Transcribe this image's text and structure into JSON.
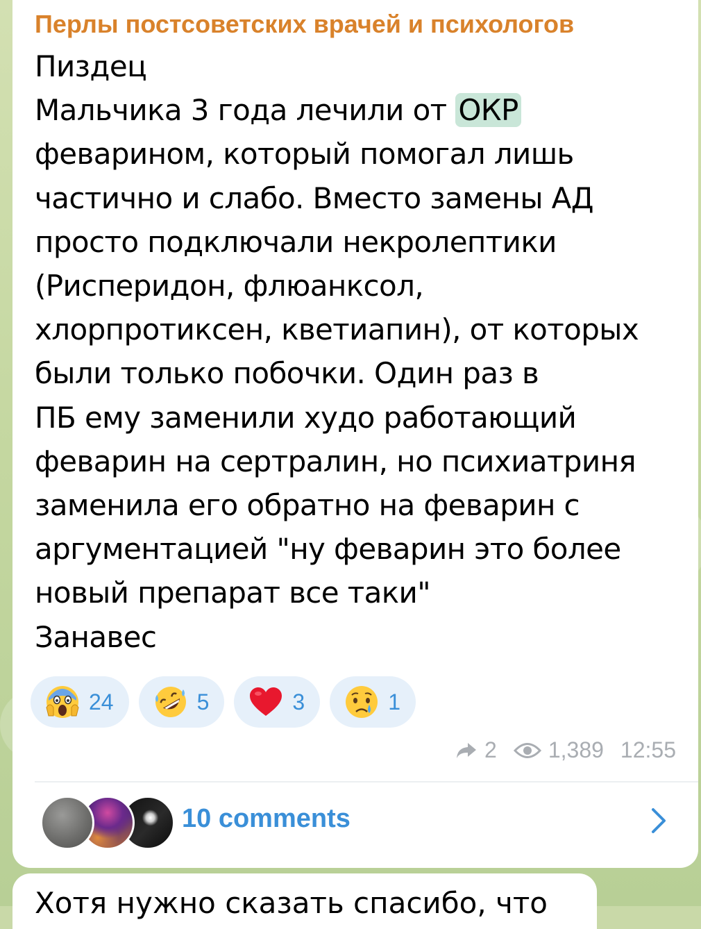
{
  "channel": {
    "name": "Перлы постсоветских врачей и психологов"
  },
  "message": {
    "lines": [
      "Пиздец",
      "Мальчика 3 года лечили от ",
      "феварином, который помогал лишь",
      "частично и слабо. Вместо замены АД",
      "просто подключали некролептики",
      "(Рисперидон, флюанксол,",
      "хлорпротиксен, кветиапин), от которых",
      "были только побочки. Один раз в",
      "ПБ ему заменили худо работающий",
      "феварин на сертралин, но психиатриня",
      "заменила его обратно на феварин с",
      "аргументацией \"ну феварин это более",
      "новый препарат все таки\"",
      "Занавес"
    ],
    "highlight": "ОКР"
  },
  "reactions": [
    {
      "emoji": "screaming-face",
      "count": "24"
    },
    {
      "emoji": "rolling-on-floor-laughing",
      "count": "5"
    },
    {
      "emoji": "red-heart",
      "count": "3"
    },
    {
      "emoji": "crying-face",
      "count": "1"
    }
  ],
  "meta": {
    "forwards": "2",
    "views": "1,389",
    "time": "12:55"
  },
  "comments": {
    "label": "10 comments"
  },
  "next_message": {
    "text": "Хотя нужно сказать спасибо, что"
  },
  "colors": {
    "channel_name": "#d9822b",
    "accent": "#3a8fd8",
    "reaction_bg": "#e6f0fa",
    "highlight_bg": "#c9e6d8",
    "meta": "#a9adb2"
  }
}
